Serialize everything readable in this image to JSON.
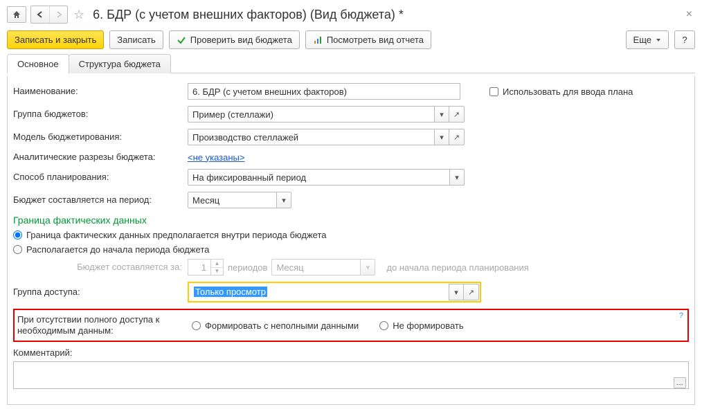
{
  "header": {
    "title": "6. БДР (с учетом внешних факторов) (Вид бюджета) *"
  },
  "cmdbar": {
    "save_close": "Записать и закрыть",
    "save": "Записать",
    "check": "Проверить вид бюджета",
    "view_report": "Посмотреть вид отчета",
    "more": "Еще"
  },
  "tabs": {
    "main": "Основное",
    "structure": "Структура бюджета"
  },
  "sections": {
    "boundary": "Граница фактических данных"
  },
  "fields": {
    "name": {
      "label": "Наименование:",
      "value": "6. БДР (с учетом внешних факторов)"
    },
    "use_for_plan": {
      "label": "Использовать для ввода плана"
    },
    "budget_group": {
      "label": "Группа бюджетов:",
      "value": "Пример (стеллажи)"
    },
    "model": {
      "label": "Модель бюджетирования:",
      "value": "Производство стеллажей"
    },
    "analytics": {
      "label": "Аналитические разрезы бюджета:",
      "value": "<не указаны>"
    },
    "planning_method": {
      "label": "Способ планирования:",
      "value": "На фиксированный период"
    },
    "period": {
      "label": "Бюджет составляется на период:",
      "value": "Месяц"
    },
    "boundary": {
      "opt_inside": "Граница фактических данных предполагается внутри периода бюджета",
      "opt_before": "Располагается до начала периода бюджета"
    },
    "compiled_for": {
      "label": "Бюджет составляется за:",
      "count": "1",
      "periods_word": "периодов",
      "unit": "Месяц",
      "suffix": "до начала периода планирования"
    },
    "access_group": {
      "label": "Группа доступа:",
      "value": "Только просмотр"
    },
    "no_access": {
      "label": "При отсутствии полного доступа к необходимым данным:",
      "opt_partial": "Формировать с неполными данными",
      "opt_none": "Не формировать"
    },
    "comment": {
      "label": "Комментарий:"
    }
  }
}
